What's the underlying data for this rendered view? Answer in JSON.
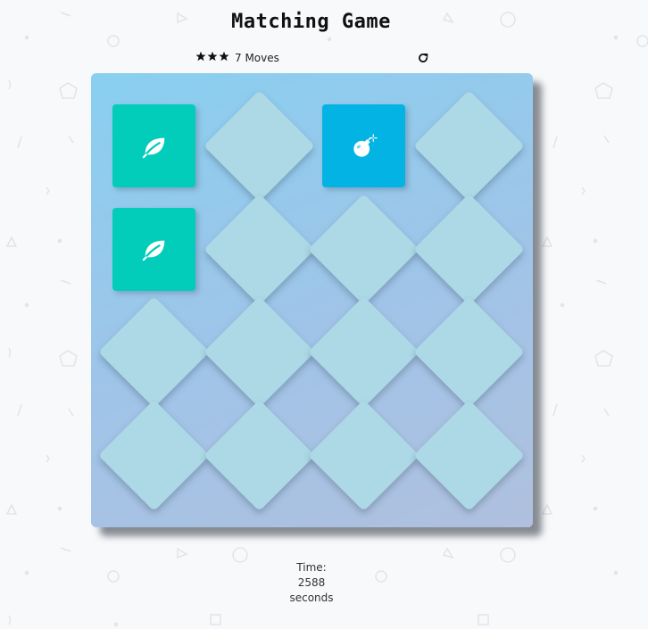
{
  "game": {
    "title": "Matching Game",
    "stars": 3,
    "moves": 7,
    "moves_label": "7 Moves",
    "restart_icon": "restart-icon",
    "timer_label": "Time:",
    "timer_value": 2588,
    "timer_value_text": "2588",
    "timer_unit": "seconds"
  },
  "colors": {
    "card_hidden": "#add8e6",
    "card_match": "#02ccba",
    "card_open": "#02b3e4",
    "deck_top": "#89cff0",
    "deck_bottom": "#b0c0de"
  },
  "deck": {
    "rows": 4,
    "cols": 4,
    "cards": [
      {
        "state": "match",
        "icon": "leaf-icon"
      },
      {
        "state": "hidden",
        "icon": ""
      },
      {
        "state": "open",
        "icon": "bomb-icon"
      },
      {
        "state": "hidden",
        "icon": ""
      },
      {
        "state": "match",
        "icon": "leaf-icon"
      },
      {
        "state": "hidden",
        "icon": ""
      },
      {
        "state": "hidden",
        "icon": ""
      },
      {
        "state": "hidden",
        "icon": ""
      },
      {
        "state": "hidden",
        "icon": ""
      },
      {
        "state": "hidden",
        "icon": ""
      },
      {
        "state": "hidden",
        "icon": ""
      },
      {
        "state": "hidden",
        "icon": ""
      },
      {
        "state": "hidden",
        "icon": ""
      },
      {
        "state": "hidden",
        "icon": ""
      },
      {
        "state": "hidden",
        "icon": ""
      },
      {
        "state": "hidden",
        "icon": ""
      }
    ]
  }
}
